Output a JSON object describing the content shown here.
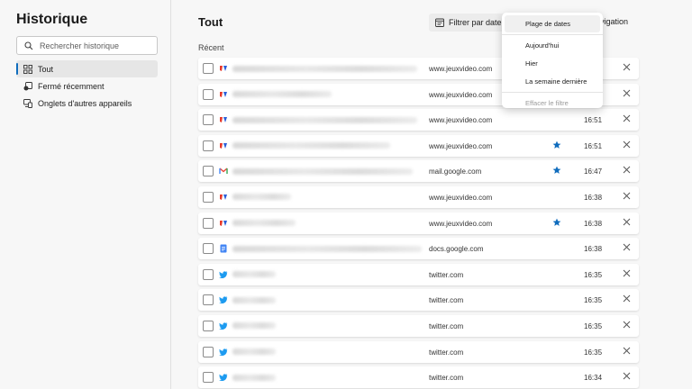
{
  "sidebar": {
    "title": "Historique",
    "search_placeholder": "Rechercher historique",
    "items": [
      {
        "label": "Tout",
        "active": true
      },
      {
        "label": "Fermé récemment",
        "active": false
      },
      {
        "label": "Onglets d'autres appareils",
        "active": false
      }
    ]
  },
  "main": {
    "title": "Tout",
    "filter_label": "Filtrer par date",
    "nav_link": "avigation",
    "section_label": "Récent"
  },
  "dropdown": {
    "items": [
      "Plage de dates",
      "Aujourd'hui",
      "Hier",
      "La semaine dernière"
    ],
    "clear_label": "Effacer le filtre"
  },
  "colors": {
    "accent": "#0f6cbd",
    "jv_red": "#e8392a",
    "twitter_blue": "#1d9bf0",
    "docs_blue": "#4285f4"
  },
  "history": [
    {
      "icon": "jeuxvideo-icon",
      "domain": "www.jeuxvideo.com",
      "time": "",
      "starred": false
    },
    {
      "icon": "jeuxvideo-icon",
      "domain": "www.jeuxvideo.com",
      "time": "",
      "starred": false
    },
    {
      "icon": "jeuxvideo-icon",
      "domain": "www.jeuxvideo.com",
      "time": "16:51",
      "starred": false
    },
    {
      "icon": "jeuxvideo-icon",
      "domain": "www.jeuxvideo.com",
      "time": "16:51",
      "starred": true
    },
    {
      "icon": "gmail-icon",
      "domain": "mail.google.com",
      "time": "16:47",
      "starred": true
    },
    {
      "icon": "jeuxvideo-icon",
      "domain": "www.jeuxvideo.com",
      "time": "16:38",
      "starred": false
    },
    {
      "icon": "jeuxvideo-icon",
      "domain": "www.jeuxvideo.com",
      "time": "16:38",
      "starred": true
    },
    {
      "icon": "google-docs-icon",
      "domain": "docs.google.com",
      "time": "16:38",
      "starred": false
    },
    {
      "icon": "twitter-icon",
      "domain": "twitter.com",
      "time": "16:35",
      "starred": false
    },
    {
      "icon": "twitter-icon",
      "domain": "twitter.com",
      "time": "16:35",
      "starred": false
    },
    {
      "icon": "twitter-icon",
      "domain": "twitter.com",
      "time": "16:35",
      "starred": false
    },
    {
      "icon": "twitter-icon",
      "domain": "twitter.com",
      "time": "16:35",
      "starred": false
    },
    {
      "icon": "twitter-icon",
      "domain": "twitter.com",
      "time": "16:34",
      "starred": false
    }
  ]
}
